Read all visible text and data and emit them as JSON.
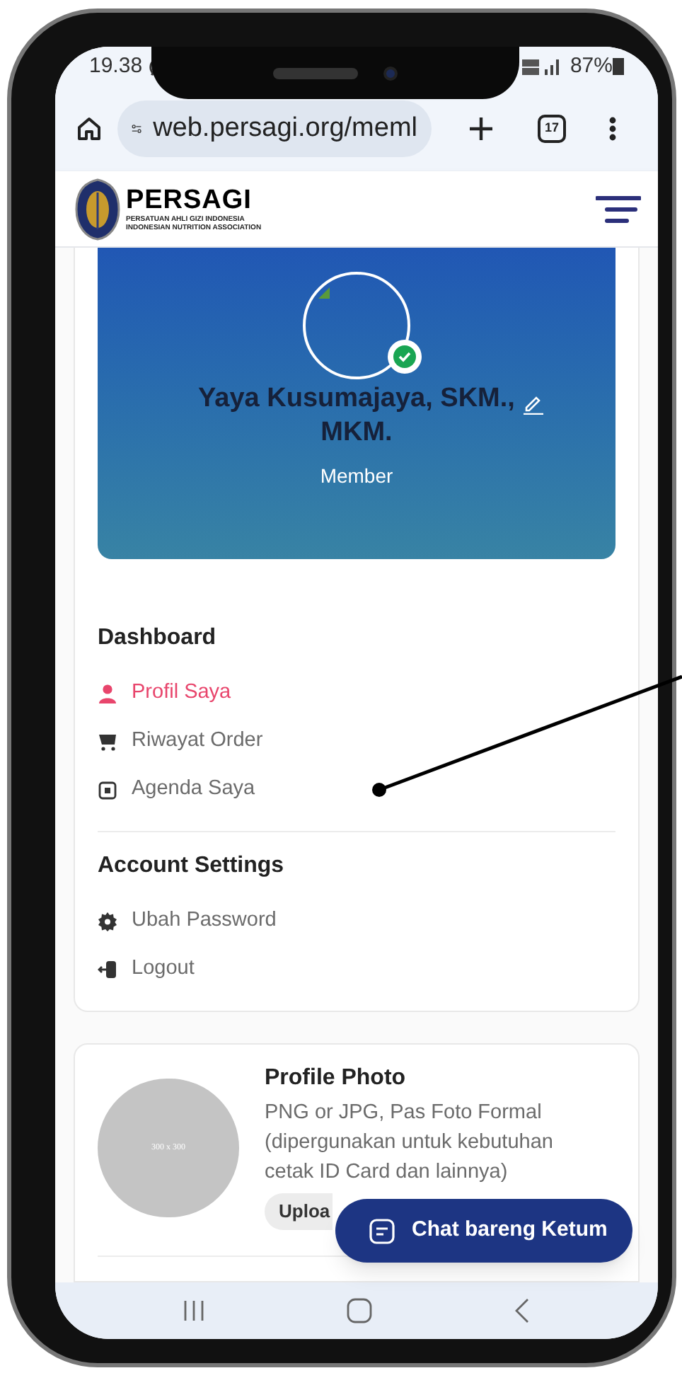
{
  "status_bar": {
    "time": "19.38",
    "battery": "87%"
  },
  "browser": {
    "url": "web.persagi.org/meml",
    "tab_count": "17"
  },
  "site_header": {
    "name": "PERSAGI",
    "subtitle_1": "PERSATUAN AHLI GIZI INDONESIA",
    "subtitle_2": "INDONESIAN NUTRITION ASSOCIATION"
  },
  "profile_card": {
    "name": "Yaya Kusumajaya, SKM., MKM.",
    "role": "Member",
    "verified": true
  },
  "menu_sections": [
    {
      "title": "Dashboard",
      "items": [
        {
          "label": "Profil Saya",
          "selected": true
        },
        {
          "label": "Riwayat Order",
          "selected": false
        },
        {
          "label": "Agenda Saya",
          "selected": false
        }
      ]
    },
    {
      "title": "Account Settings",
      "items": [
        {
          "label": "Ubah Password",
          "selected": false
        },
        {
          "label": "Logout",
          "selected": false
        }
      ]
    }
  ],
  "photo_card": {
    "title": "Profile Photo",
    "description": "PNG or JPG, Pas Foto Formal (dipergunakan untuk kebutuhan cetak ID Card dan lainnya)",
    "placeholder_label": "300 x 300",
    "upload_button": "Uploa"
  },
  "chat_button": {
    "label": "Chat bareng Ketum"
  }
}
